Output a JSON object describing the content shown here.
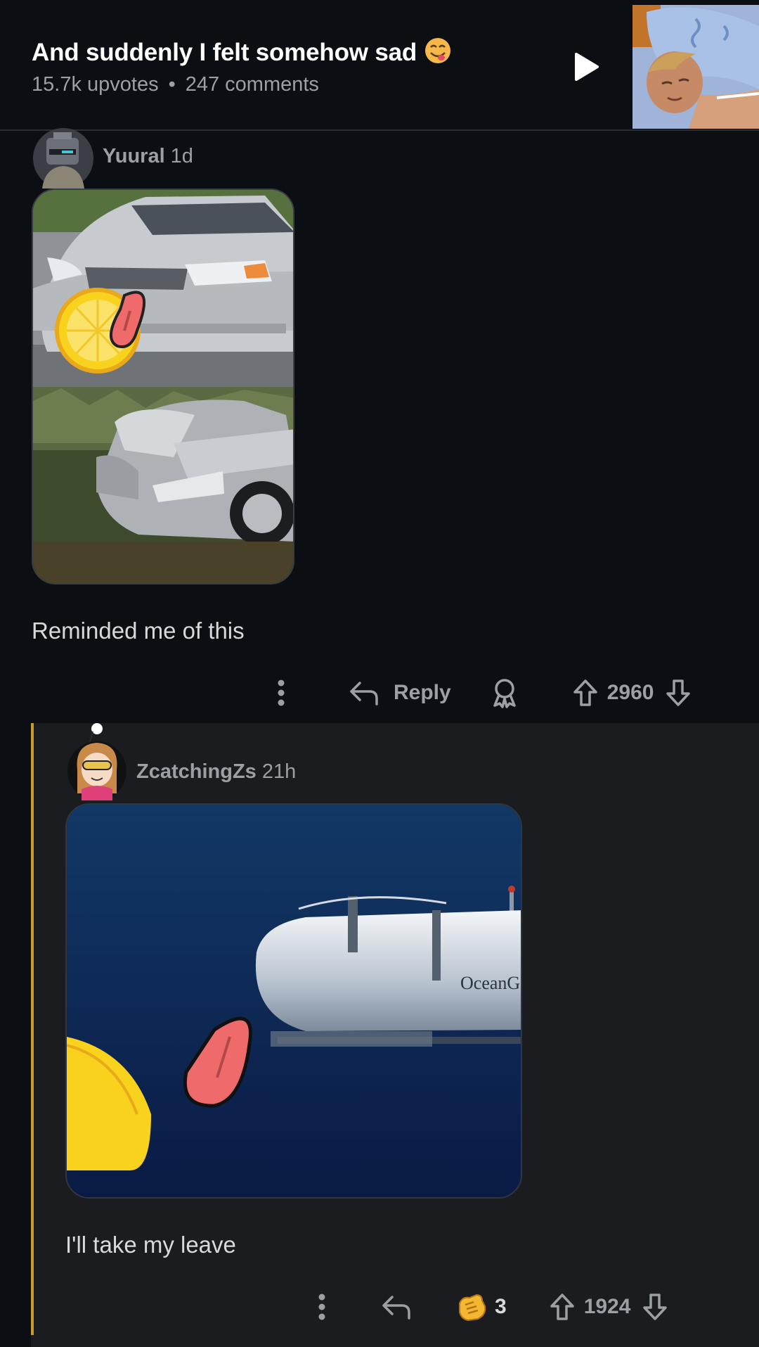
{
  "post": {
    "title": "And suddenly I felt somehow sad",
    "title_emoji": "😋",
    "upvotes": "15.7k upvotes",
    "separator": "•",
    "comments": "247 comments"
  },
  "comments": [
    {
      "author": "Yuural",
      "age": "1d",
      "text": "Reminded me of this",
      "reply_label": "Reply",
      "score": "2960"
    },
    {
      "author": "ZcatchingZs",
      "age": "21h",
      "text": "I'll take my leave",
      "award_count": "3",
      "score": "1924",
      "media_caption": "OceanG"
    }
  ],
  "colors": {
    "background": "#0b0e12",
    "reply_background": "#1a1c20",
    "thread_line": "#c99a2e",
    "muted_text": "#9aa0a6",
    "lemon": "#f8d21c",
    "tongue": "#ef6b6b"
  },
  "icons": [
    "play-icon",
    "more-icon",
    "reply-icon",
    "award-icon",
    "upvote-icon",
    "downvote-icon"
  ]
}
